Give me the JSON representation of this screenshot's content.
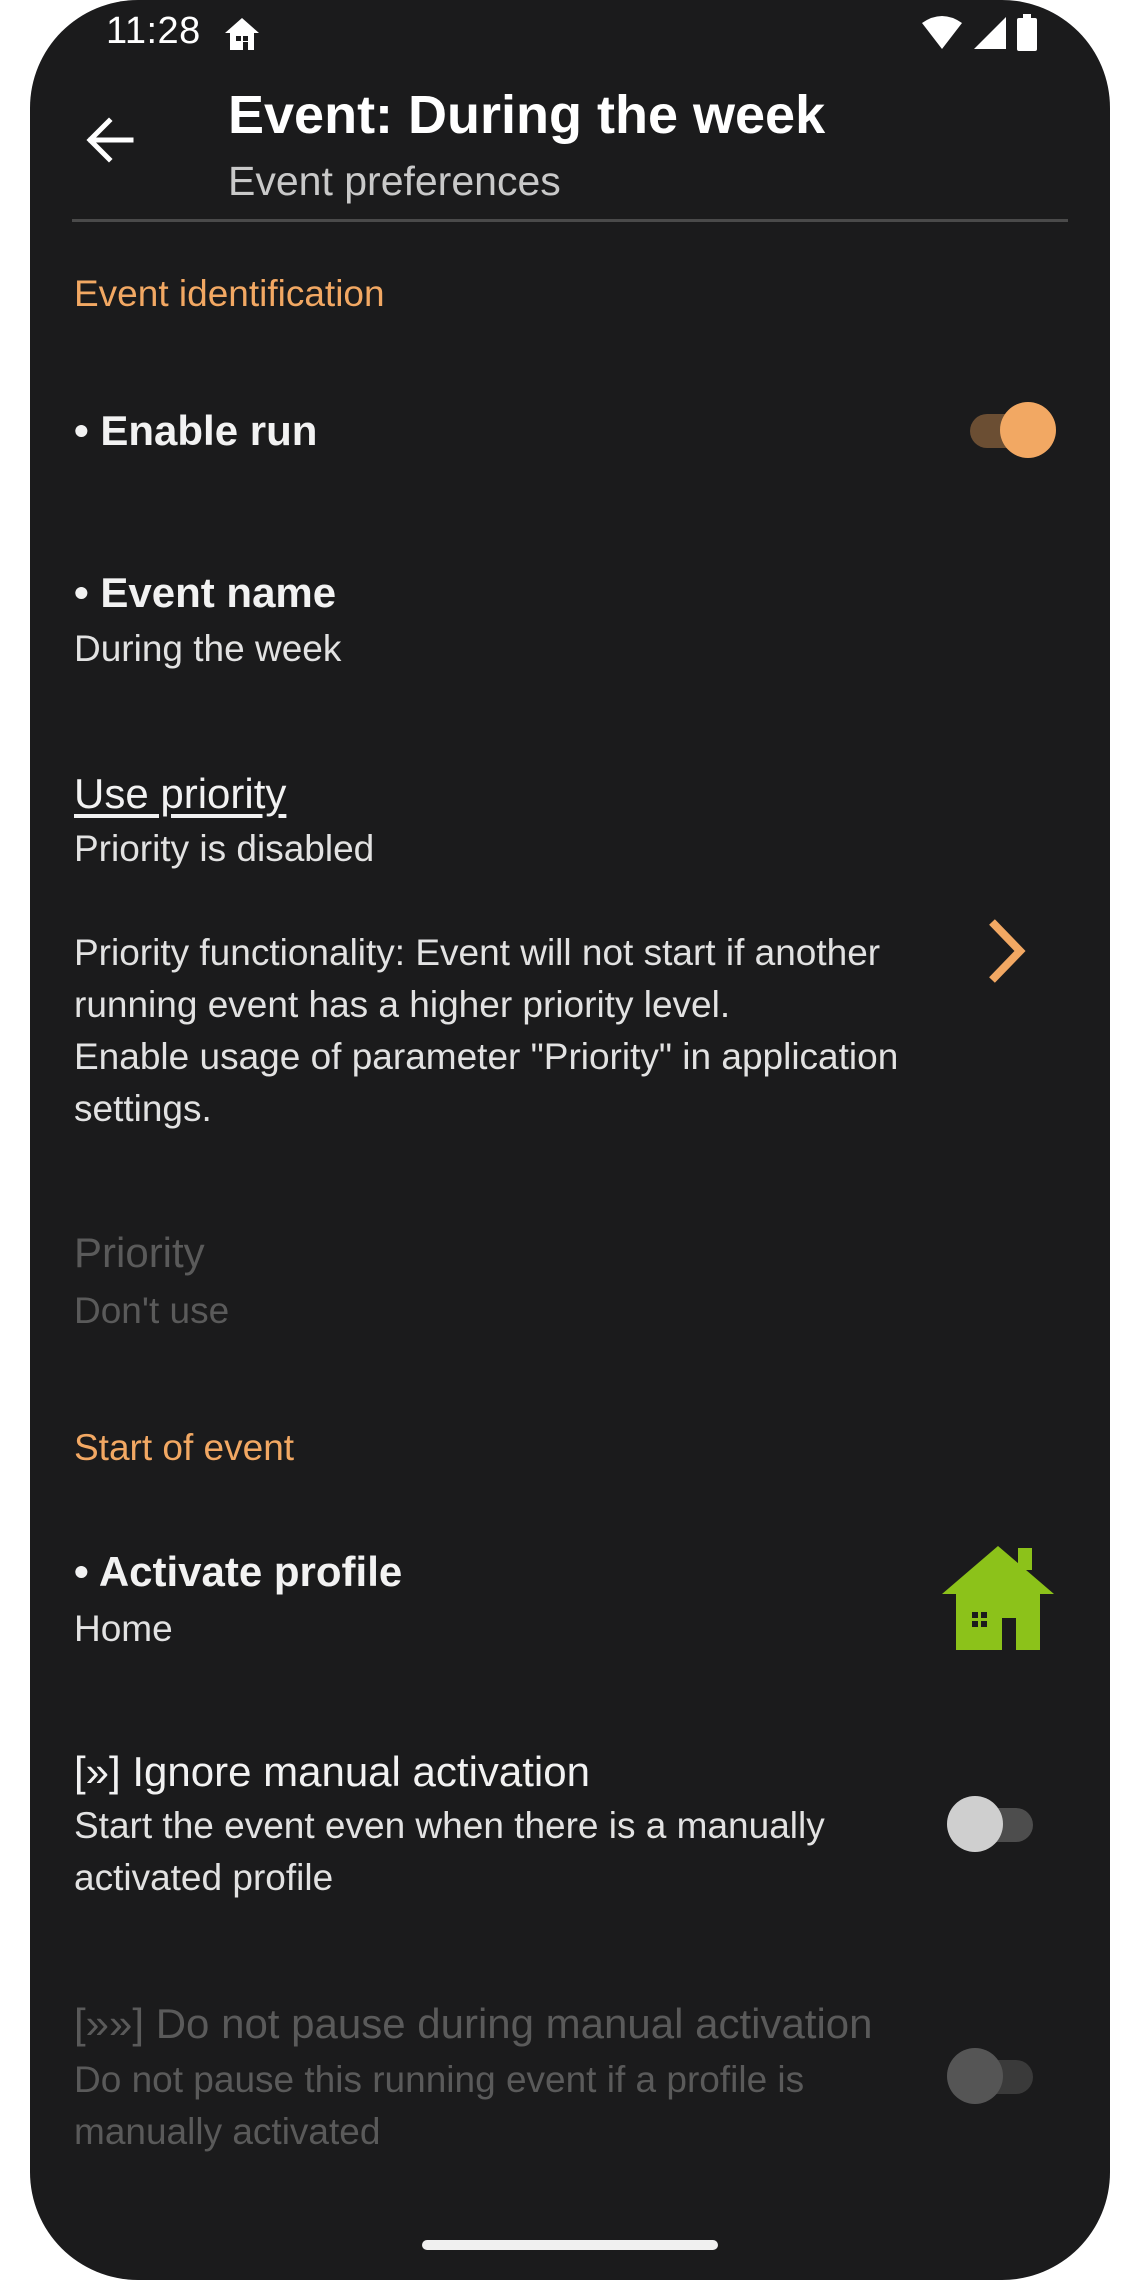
{
  "status_bar": {
    "time": "11:28",
    "icons": [
      "home-icon",
      "wifi-icon",
      "cellular-signal-icon",
      "battery-icon"
    ]
  },
  "toolbar": {
    "title": "Event: During the week",
    "subtitle": "Event preferences",
    "back_icon": "arrow-back-icon"
  },
  "sections": {
    "identification": {
      "header": "Event identification",
      "enable_run": {
        "title": "• Enable run",
        "checked": true
      },
      "event_name": {
        "title": "• Event name",
        "summary": "During the week"
      },
      "use_priority": {
        "title": "Use priority",
        "summary": "Priority is disabled",
        "description_line1": "Priority functionality: Event will not start if another",
        "description_line2": "running event has a higher priority level.",
        "description_line3": "Enable usage of parameter \"Priority\" in application",
        "description_line4": "settings."
      },
      "priority": {
        "title": "Priority",
        "summary": "Don't use",
        "enabled": false
      }
    },
    "start": {
      "header": "Start of event",
      "activate_profile": {
        "title": "• Activate profile",
        "summary": "Home",
        "icon": "home-profile-icon"
      },
      "ignore_manual": {
        "title": "[»] Ignore manual activation",
        "summary_line1": "Start the event even when there is a manually",
        "summary_line2": "activated profile",
        "checked": false
      },
      "no_pause": {
        "title": "[»»] Do not pause during manual activation",
        "summary_line1": "Do not pause this running event if a profile is",
        "summary_line2": "manually activated",
        "checked": false,
        "enabled": false
      }
    }
  },
  "colors": {
    "background": "#1b1b1c",
    "accent": "#f2a863",
    "profile_icon": "#8cc21a",
    "disabled_text": "#5a5a5a"
  }
}
